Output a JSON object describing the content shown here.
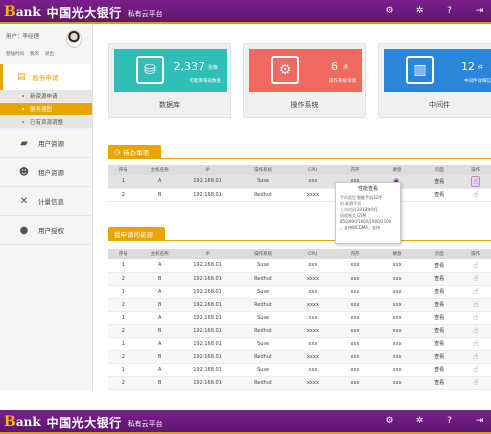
{
  "brand": {
    "logo_b": "B",
    "logo_rest": "ank",
    "bank_name": "中国光大银行",
    "platform": "私有云平台"
  },
  "top_icons": [
    "gear-icon",
    "settings-icon",
    "help-icon",
    "logout-icon"
  ],
  "user": {
    "label": "用户：李经理",
    "links": [
      "登陆时间",
      "我的",
      "退出"
    ]
  },
  "sidebar": {
    "active": {
      "label": "服务申请",
      "icon": "clipboard-icon"
    },
    "submenu": [
      "新资源申请",
      "服务器图",
      "已有资源调整"
    ],
    "selected_sub": 1,
    "items": [
      {
        "label": "用户资源",
        "icon": "folder-icon"
      },
      {
        "label": "租户资源",
        "icon": "users-icon"
      },
      {
        "label": "计量信息",
        "icon": "tools-icon"
      },
      {
        "label": "用户授权",
        "icon": "user-icon"
      }
    ]
  },
  "cards": [
    {
      "title": "数据库",
      "number": "2,337",
      "unit": "张帐",
      "caption": "可能库每班数查",
      "color": "#2ebfb6",
      "icon": "database-icon"
    },
    {
      "title": "操作系统",
      "number": "6",
      "unit": "项",
      "caption": "操作系统详情",
      "color": "#f0695f",
      "icon": "os-icon"
    },
    {
      "title": "中间件",
      "number": "12",
      "unit": "件",
      "caption": "中间件详细信",
      "color": "#2b86d9",
      "icon": "middleware-icon"
    }
  ],
  "pending": {
    "title": "待办事项",
    "headers": [
      "序号",
      "主机名称",
      "IP",
      "操作系统",
      "CPU",
      "内存",
      "硬盘",
      "页面",
      "操作"
    ],
    "rows": [
      [
        "1",
        "A",
        "192.168.01",
        "Suse",
        "xxx",
        "xxx",
        "",
        "查看",
        ""
      ],
      [
        "2",
        "B",
        "192.168.01",
        "Redhut",
        "xxxx",
        "xxx",
        "xxx",
        "查看",
        ""
      ]
    ]
  },
  "tooltip": {
    "title": "性能查看",
    "rows": [
      {
        "k": "手机类型",
        "v": "智能手机3G手"
      },
      {
        "k": "机.新野手机",
        "v": ""
      },
      {
        "k": "上市时间",
        "v": "2013年9月"
      },
      {
        "k": "网络制式",
        "v": "GSM"
      }
    ],
    "extra": [
      "850/900/1800/1900/2100",
      "，支持WCDMA，支持"
    ]
  },
  "resources": {
    "title": "我申请的资源",
    "headers": [
      "序号",
      "主机名称",
      "IP",
      "操作系统",
      "CPU",
      "内存",
      "硬盘",
      "页面",
      "操作"
    ],
    "rows": [
      [
        "1",
        "A",
        "192.168.01",
        "Suse",
        "xxx",
        "xxx",
        "xxx",
        "查看",
        ""
      ],
      [
        "2",
        "B",
        "192.168.01",
        "Redhut",
        "xxxx",
        "xxx",
        "xxx",
        "查看",
        ""
      ],
      [
        "1",
        "A",
        "192.168.01",
        "Suse",
        "xxx",
        "xxx",
        "xxx",
        "查看",
        ""
      ],
      [
        "2",
        "B",
        "192.168.01",
        "Redhut",
        "xxxx",
        "xxx",
        "xxx",
        "查看",
        ""
      ],
      [
        "1",
        "A",
        "192.168.01",
        "Suse",
        "xxx",
        "xxx",
        "xxx",
        "查看",
        ""
      ],
      [
        "2",
        "B",
        "192.168.01",
        "Redhut",
        "xxxx",
        "xxx",
        "xxx",
        "查看",
        ""
      ],
      [
        "1",
        "A",
        "192.168.01",
        "Suse",
        "xxx",
        "xxx",
        "xxx",
        "查看",
        ""
      ],
      [
        "2",
        "B",
        "192.168.01",
        "Redhut",
        "xxxx",
        "xxx",
        "xxx",
        "查看",
        ""
      ],
      [
        "1",
        "A",
        "192.168.01",
        "Suse",
        "xxx",
        "xxx",
        "xxx",
        "查看",
        ""
      ],
      [
        "2",
        "B",
        "192.168.01",
        "Redhut",
        "xxxx",
        "xxx",
        "xxx",
        "查看",
        ""
      ]
    ]
  }
}
